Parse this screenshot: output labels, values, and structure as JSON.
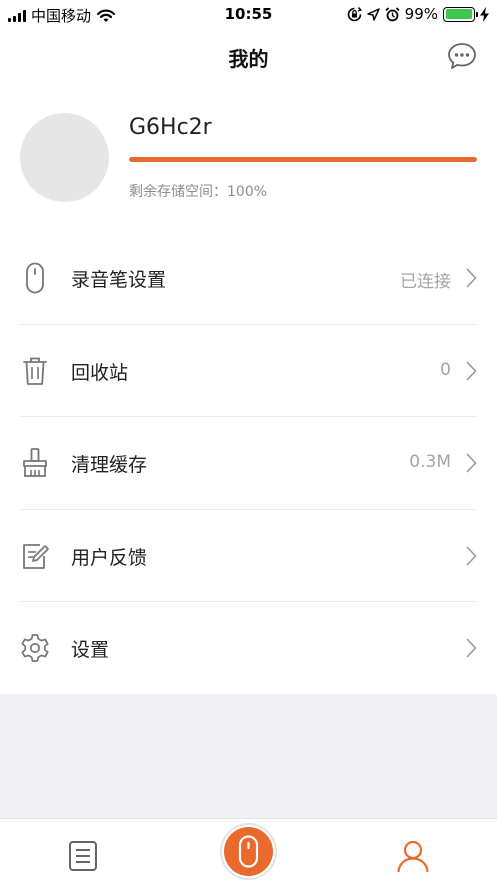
{
  "status_bar": {
    "carrier": "中国移动",
    "time": "10:55",
    "battery_percent": "99%",
    "battery_level": 0.99,
    "icons": [
      "signal-icon",
      "wifi-icon",
      "orientation-lock-icon",
      "location-icon",
      "alarm-icon",
      "battery-icon",
      "charging-icon"
    ]
  },
  "nav": {
    "title": "我的",
    "right_icon": "chat-bubble-icon"
  },
  "profile": {
    "username": "G6Hc2r",
    "storage_label": "剩余存储空间：100%",
    "storage_fraction": 1.0
  },
  "menu": [
    {
      "label": "录音笔设置",
      "value": "已连接",
      "icon": "recorder-pen-icon"
    },
    {
      "label": "回收站",
      "value": "0",
      "icon": "trash-icon"
    },
    {
      "label": "清理缓存",
      "value": "0.3M",
      "icon": "broom-icon"
    },
    {
      "label": "用户反馈",
      "value": "",
      "icon": "feedback-edit-icon"
    },
    {
      "label": "设置",
      "value": "",
      "icon": "gear-icon"
    }
  ],
  "tabs": [
    {
      "icon": "list-document-icon",
      "active": false
    },
    {
      "icon": "record-microphone-icon",
      "active": false
    },
    {
      "icon": "user-profile-icon",
      "active": true
    }
  ],
  "colors": {
    "accent": "#ea6a2e",
    "battery": "#3ec74b",
    "divider": "#ececec",
    "muted_text": "#a5a5a5",
    "background_grey": "#f1f1f3"
  }
}
